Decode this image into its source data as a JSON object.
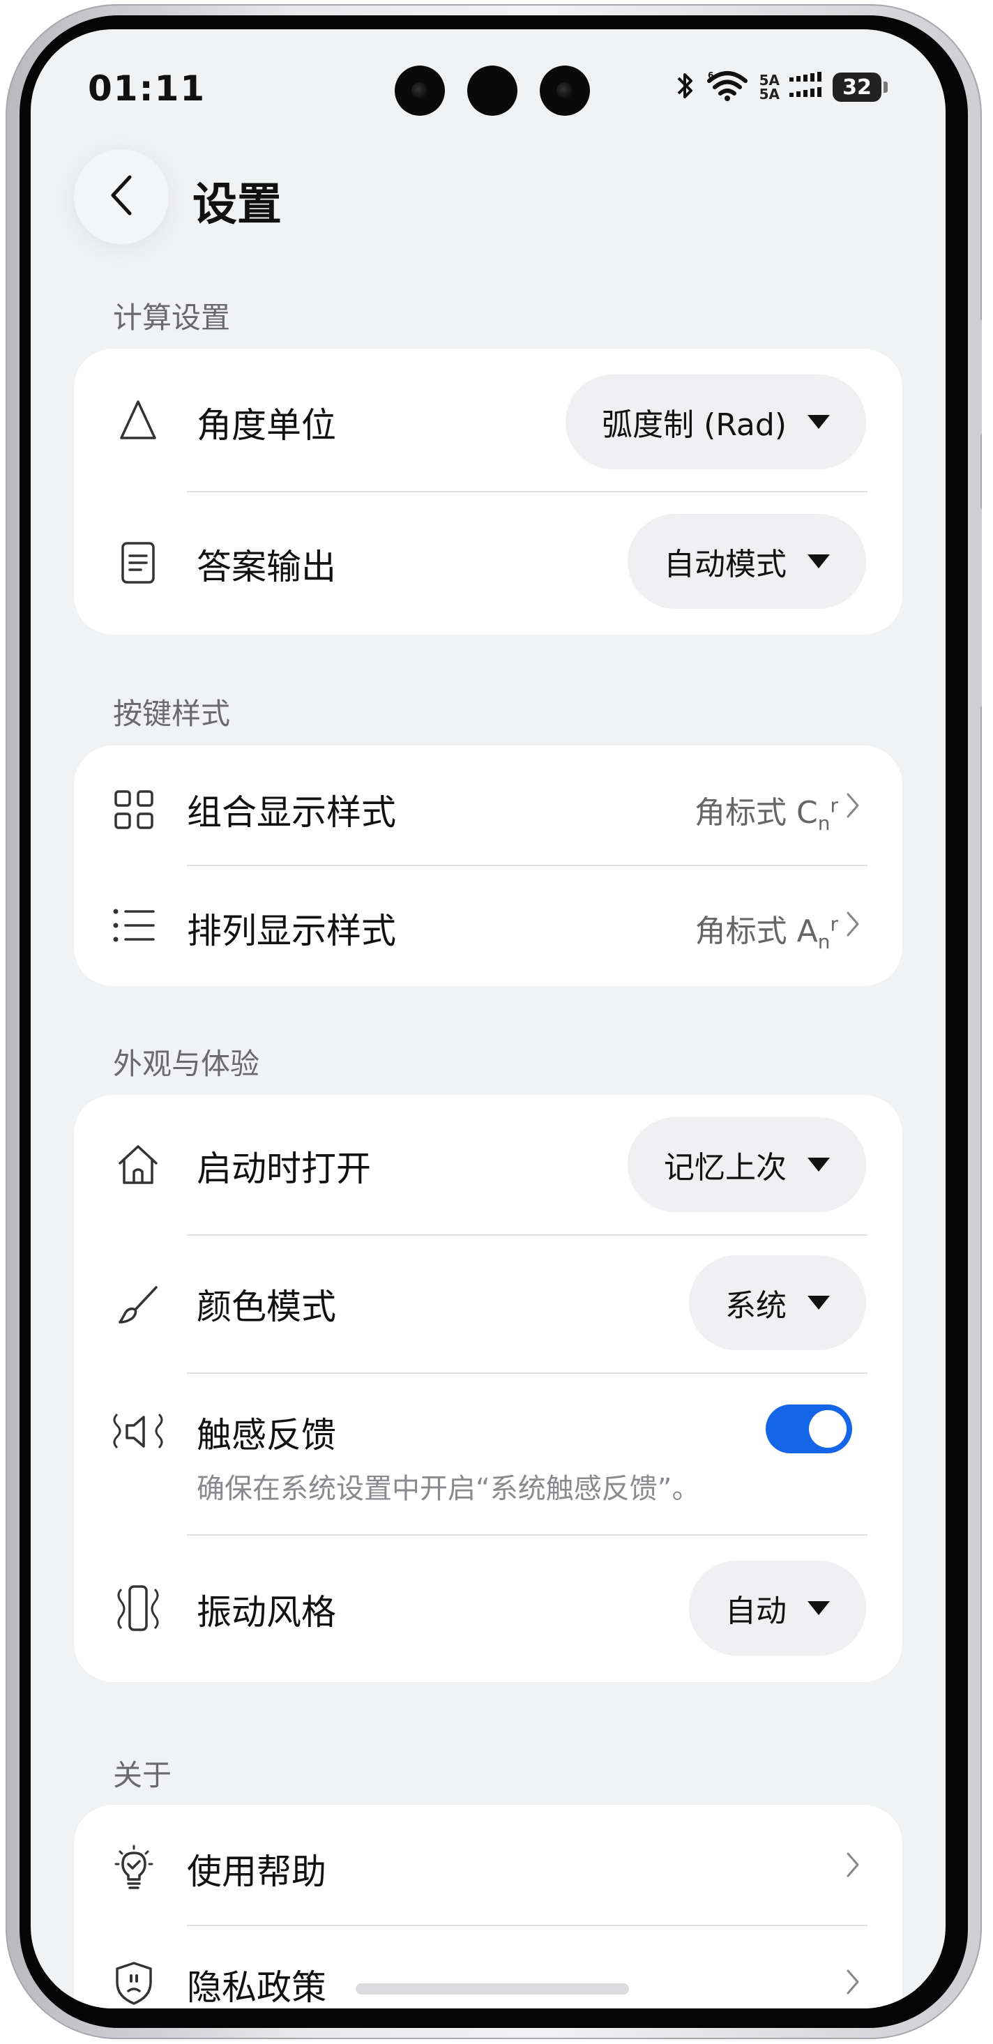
{
  "status_bar": {
    "time": "01:11",
    "signal_label_top": "5A",
    "signal_label_bottom": "5A",
    "battery": "32"
  },
  "header": {
    "title": "设置"
  },
  "sections": {
    "calc": {
      "label": "计算设置",
      "angle_unit": {
        "label": "角度单位",
        "value": "弧度制 (Rad)"
      },
      "answer_output": {
        "label": "答案输出",
        "value": "自动模式"
      }
    },
    "keys": {
      "label": "按键样式",
      "combination": {
        "label": "组合显示样式",
        "value_prefix": "角标式 C",
        "value_sub": "n",
        "value_sup": "r"
      },
      "permutation": {
        "label": "排列显示样式",
        "value_prefix": "角标式 A",
        "value_sub": "n",
        "value_sup": "r"
      }
    },
    "appearance": {
      "label": "外观与体验",
      "launch": {
        "label": "启动时打开",
        "value": "记忆上次"
      },
      "color_mode": {
        "label": "颜色模式",
        "value": "系统"
      },
      "haptics": {
        "label": "触感反馈",
        "enabled": true,
        "hint": "确保在系统设置中开启“系统触感反馈”。"
      },
      "vibration": {
        "label": "振动风格",
        "value": "自动"
      }
    },
    "about": {
      "label": "关于",
      "help": {
        "label": "使用帮助"
      },
      "privacy": {
        "label": "隐私政策"
      }
    }
  },
  "colors": {
    "accent": "#1565e8",
    "background": "#f1f2f4",
    "card": "#ffffff"
  }
}
